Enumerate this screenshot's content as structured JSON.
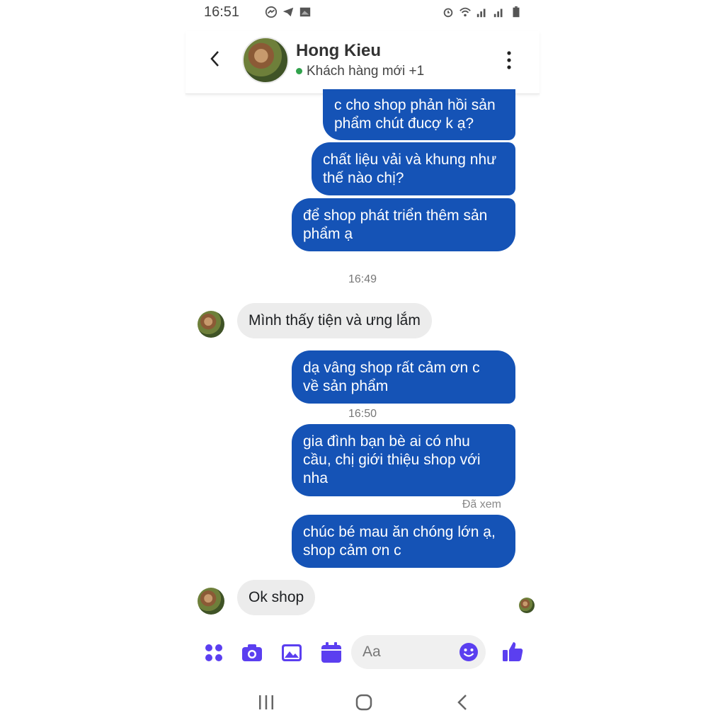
{
  "status_bar": {
    "time": "16:51"
  },
  "header": {
    "name": "Hong Kieu",
    "subtitle": "Khách hàng mới +1"
  },
  "messages": [
    {
      "lines": [
        "c cho shop phản hồi sản",
        "phẩm chút đucợ k ạ?"
      ]
    },
    {
      "lines": [
        "chất liệu vải và khung như",
        "thế nào chị?"
      ]
    },
    {
      "lines": [
        "để shop phát triển thêm sản",
        "phẩm ạ"
      ]
    },
    {
      "time": "16:49"
    },
    {
      "text": "Mình thấy tiện và ưng lắm"
    },
    {
      "lines": [
        "dạ vâng shop rất cảm ơn c",
        "về sản phẩm"
      ]
    },
    {
      "time": "16:50"
    },
    {
      "lines": [
        "gia đình bạn bè ai có nhu",
        "cầu, chị giới thiệu shop với",
        "nha"
      ]
    },
    {
      "seen": "Đã xem"
    },
    {
      "lines": [
        "chúc bé mau ăn chóng lớn ạ,",
        "shop cảm ơn c"
      ]
    },
    {
      "text": "Ok shop"
    }
  ],
  "composer": {
    "placeholder": "Aa"
  },
  "colors": {
    "outgoing_bubble": "#1553b6",
    "incoming_bubble": "#ececec",
    "accent": "#5b3ff0"
  },
  "icons": [
    "messenger-icon",
    "telegram-icon",
    "gallery-icon",
    "alarm-icon",
    "wifi-icon",
    "signal-icon",
    "battery-icon",
    "back-icon",
    "more-icon",
    "apps-icon",
    "camera-icon",
    "image-icon",
    "calendar-icon",
    "emoji-icon",
    "thumbs-up-icon",
    "recent-apps-icon",
    "home-icon",
    "nav-back-icon"
  ]
}
